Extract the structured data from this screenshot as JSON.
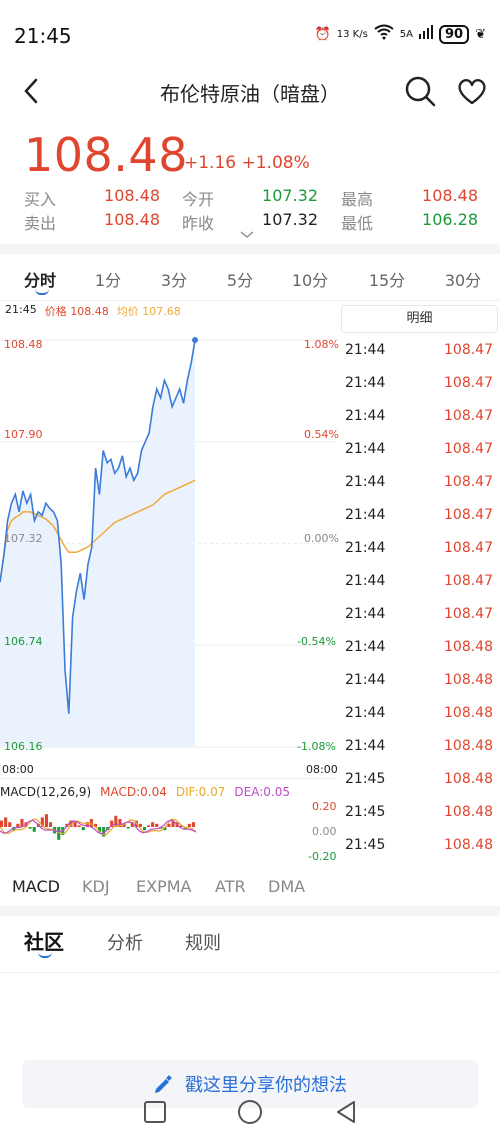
{
  "status_bar": {
    "time": "21:45",
    "net_speed": "13 K/s",
    "signal_a": "6",
    "signal_b": "5A",
    "battery": "90"
  },
  "header": {
    "title": "布伦特原油（暗盘）",
    "back_icon": "chevron-left-icon",
    "search_icon": "search-icon",
    "favorite_icon": "heart-icon"
  },
  "quote": {
    "price": "108.48",
    "change": "+1.16 +1.08%",
    "bid_label": "买入",
    "bid": "108.48",
    "ask_label": "卖出",
    "ask": "108.48",
    "open_label": "今开",
    "open": "107.32",
    "prev_close_label": "昨收",
    "prev_close": "107.32",
    "high_label": "最高",
    "high": "108.48",
    "low_label": "最低",
    "low": "106.28",
    "up_color": "#e0462f",
    "down_color": "#1a9b3a"
  },
  "period_tabs": [
    "分时",
    "1分",
    "3分",
    "5分",
    "10分",
    "15分",
    "30分"
  ],
  "active_period": "分时",
  "chart_header": {
    "time": "21:45",
    "price_text": "价格 108.48",
    "avg_text": "均价 107.68"
  },
  "chart_data": {
    "type": "line",
    "x_start_label": "08:00",
    "x_end_label": "08:00",
    "y_labels_left": [
      "108.48",
      "107.90",
      "107.32",
      "106.74",
      "106.16"
    ],
    "y_labels_right": [
      "1.08%",
      "0.54%",
      "0.00%",
      "-0.54%",
      "-1.08%"
    ],
    "ylim": [
      106.16,
      108.48
    ],
    "series": [
      {
        "name": "价格",
        "color": "#3b7bd9",
        "values": [
          107.1,
          107.25,
          107.45,
          107.55,
          107.6,
          107.5,
          107.62,
          107.55,
          107.6,
          107.45,
          107.5,
          107.48,
          107.55,
          107.52,
          107.5,
          107.45,
          107.2,
          106.6,
          106.35,
          106.9,
          107.05,
          107.15,
          107.0,
          107.2,
          107.3,
          107.75,
          107.6,
          107.85,
          107.78,
          107.8,
          107.72,
          107.75,
          107.82,
          107.7,
          107.75,
          107.68,
          107.72,
          107.85,
          107.9,
          107.95,
          108.1,
          108.2,
          108.15,
          108.25,
          108.2,
          108.1,
          108.15,
          108.2,
          108.12,
          108.25,
          108.35,
          108.48
        ]
      },
      {
        "name": "均价",
        "color": "#f0a93a",
        "values": [
          107.1,
          107.25,
          107.4,
          107.45,
          107.47,
          107.48,
          107.5,
          107.5,
          107.5,
          107.49,
          107.48,
          107.47,
          107.46,
          107.44,
          107.42,
          107.38,
          107.34,
          107.3,
          107.27,
          107.27,
          107.27,
          107.28,
          107.29,
          107.3,
          107.32,
          107.34,
          107.36,
          107.38,
          107.4,
          107.42,
          107.44,
          107.45,
          107.46,
          107.47,
          107.48,
          107.49,
          107.5,
          107.51,
          107.52,
          107.53,
          107.54,
          107.56,
          107.58,
          107.6,
          107.61,
          107.62,
          107.63,
          107.64,
          107.65,
          107.66,
          107.67,
          107.68
        ]
      }
    ]
  },
  "detail_header": "明细",
  "trades": [
    {
      "time": "21:44",
      "price": "108.47"
    },
    {
      "time": "21:44",
      "price": "108.47"
    },
    {
      "time": "21:44",
      "price": "108.47"
    },
    {
      "time": "21:44",
      "price": "108.47"
    },
    {
      "time": "21:44",
      "price": "108.47"
    },
    {
      "time": "21:44",
      "price": "108.47"
    },
    {
      "time": "21:44",
      "price": "108.47"
    },
    {
      "time": "21:44",
      "price": "108.47"
    },
    {
      "time": "21:44",
      "price": "108.47"
    },
    {
      "time": "21:44",
      "price": "108.48"
    },
    {
      "time": "21:44",
      "price": "108.48"
    },
    {
      "time": "21:44",
      "price": "108.48"
    },
    {
      "time": "21:44",
      "price": "108.48"
    },
    {
      "time": "21:45",
      "price": "108.48"
    },
    {
      "time": "21:45",
      "price": "108.48"
    },
    {
      "time": "21:45",
      "price": "108.48"
    }
  ],
  "macd": {
    "label": "MACD(12,26,9)",
    "macd": "MACD:0.04",
    "dif": "DIF:0.07",
    "dea": "DEA:0.05",
    "axis": [
      "0.20",
      "0.00",
      "-0.20"
    ]
  },
  "indicator_tabs": [
    "MACD",
    "KDJ",
    "EXPMA",
    "ATR",
    "DMA"
  ],
  "active_indicator": "MACD",
  "section_tabs": [
    "社区",
    "分析",
    "规则"
  ],
  "active_section": "社区",
  "share_placeholder": "戳这里分享你的想法"
}
